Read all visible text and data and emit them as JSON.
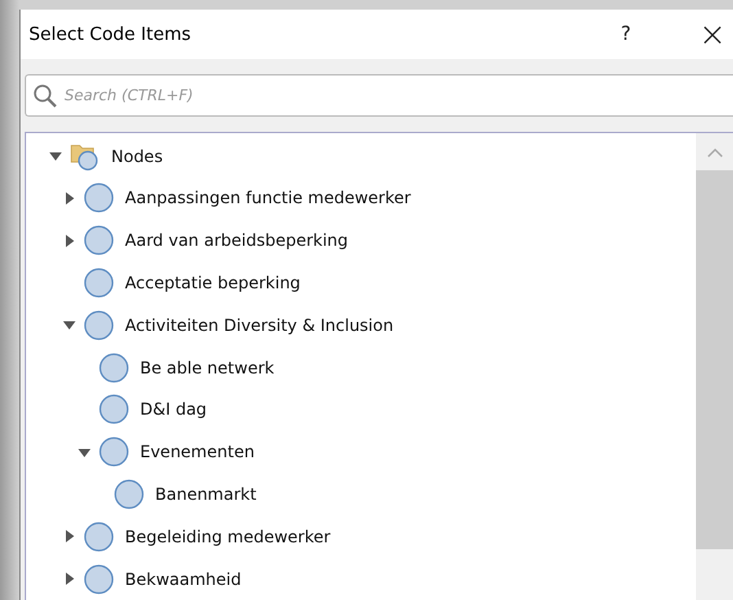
{
  "window": {
    "title": "Select Code Items",
    "help": "?",
    "close": "×"
  },
  "search": {
    "placeholder": "Search (CTRL+F)"
  },
  "tree": [
    {
      "label": "Nodes",
      "kind": "folder",
      "expanded": true,
      "children": [
        {
          "label": "Aanpassingen functie medewerker",
          "kind": "node",
          "expanded": false
        },
        {
          "label": "Aard van arbeidsbeperking",
          "kind": "node",
          "expanded": false
        },
        {
          "label": "Acceptatie beperking",
          "kind": "node"
        },
        {
          "label": "Activiteiten Diversity & Inclusion",
          "kind": "node",
          "expanded": true,
          "children": [
            {
              "label": "Be able netwerk",
              "kind": "node"
            },
            {
              "label": "D&I dag",
              "kind": "node"
            },
            {
              "label": "Evenementen",
              "kind": "node",
              "expanded": true,
              "children": [
                {
                  "label": "Banenmarkt",
                  "kind": "node"
                }
              ]
            }
          ]
        },
        {
          "label": "Begeleiding medewerker",
          "kind": "node",
          "expanded": false
        },
        {
          "label": "Bekwaamheid",
          "kind": "node",
          "expanded": false
        }
      ]
    }
  ]
}
